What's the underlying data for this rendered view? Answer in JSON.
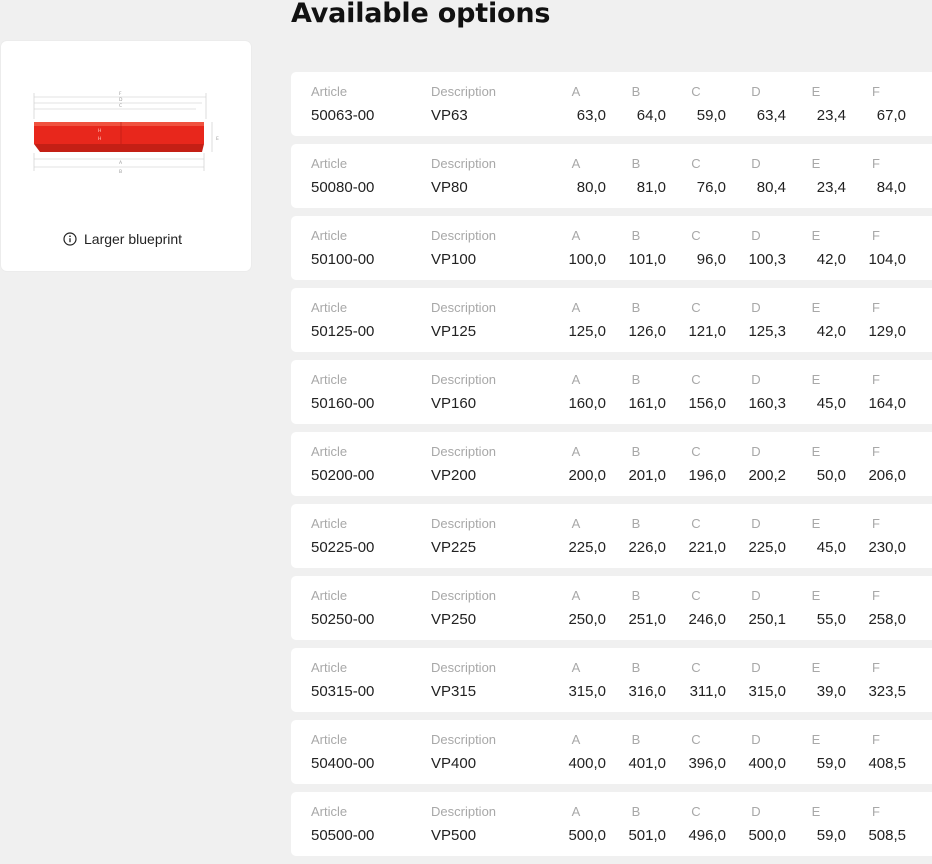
{
  "page": {
    "title": "Available options"
  },
  "blueprint": {
    "link_label": "Larger blueprint",
    "icon": "info-icon",
    "accent_color": "#e8271c",
    "dim_labels": [
      "F",
      "D",
      "C",
      "H",
      "H",
      "A",
      "B",
      "E"
    ]
  },
  "table": {
    "headers": {
      "article": "Article",
      "description": "Description",
      "a": "A",
      "b": "B",
      "c": "C",
      "d": "D",
      "e": "E",
      "f": "F"
    },
    "rows": [
      {
        "article": "50063-00",
        "description": "VP63",
        "a": "63,0",
        "b": "64,0",
        "c": "59,0",
        "d": "63,4",
        "e": "23,4",
        "f": "67,0"
      },
      {
        "article": "50080-00",
        "description": "VP80",
        "a": "80,0",
        "b": "81,0",
        "c": "76,0",
        "d": "80,4",
        "e": "23,4",
        "f": "84,0"
      },
      {
        "article": "50100-00",
        "description": "VP100",
        "a": "100,0",
        "b": "101,0",
        "c": "96,0",
        "d": "100,3",
        "e": "42,0",
        "f": "104,0"
      },
      {
        "article": "50125-00",
        "description": "VP125",
        "a": "125,0",
        "b": "126,0",
        "c": "121,0",
        "d": "125,3",
        "e": "42,0",
        "f": "129,0"
      },
      {
        "article": "50160-00",
        "description": "VP160",
        "a": "160,0",
        "b": "161,0",
        "c": "156,0",
        "d": "160,3",
        "e": "45,0",
        "f": "164,0"
      },
      {
        "article": "50200-00",
        "description": "VP200",
        "a": "200,0",
        "b": "201,0",
        "c": "196,0",
        "d": "200,2",
        "e": "50,0",
        "f": "206,0"
      },
      {
        "article": "50225-00",
        "description": "VP225",
        "a": "225,0",
        "b": "226,0",
        "c": "221,0",
        "d": "225,0",
        "e": "45,0",
        "f": "230,0"
      },
      {
        "article": "50250-00",
        "description": "VP250",
        "a": "250,0",
        "b": "251,0",
        "c": "246,0",
        "d": "250,1",
        "e": "55,0",
        "f": "258,0"
      },
      {
        "article": "50315-00",
        "description": "VP315",
        "a": "315,0",
        "b": "316,0",
        "c": "311,0",
        "d": "315,0",
        "e": "39,0",
        "f": "323,5"
      },
      {
        "article": "50400-00",
        "description": "VP400",
        "a": "400,0",
        "b": "401,0",
        "c": "396,0",
        "d": "400,0",
        "e": "59,0",
        "f": "408,5"
      },
      {
        "article": "50500-00",
        "description": "VP500",
        "a": "500,0",
        "b": "501,0",
        "c": "496,0",
        "d": "500,0",
        "e": "59,0",
        "f": "508,5"
      }
    ]
  }
}
